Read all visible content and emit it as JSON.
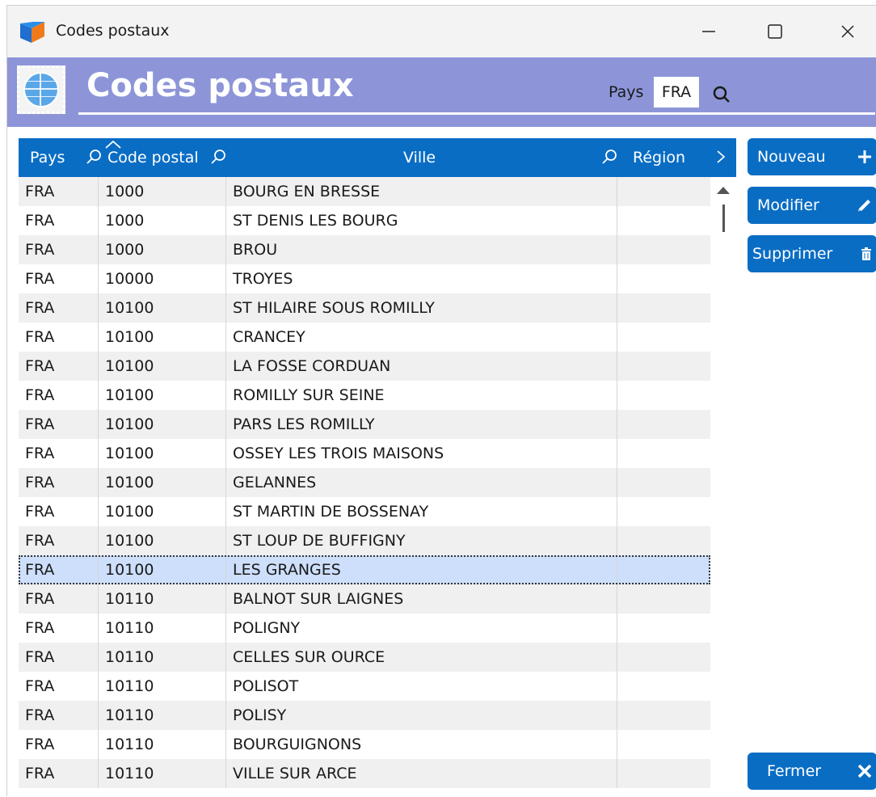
{
  "window": {
    "title": "Codes postaux"
  },
  "header": {
    "title": "Codes postaux",
    "pays_label": "Pays",
    "pays_value": "FRA"
  },
  "table": {
    "columns": [
      "Pays",
      "Code postal",
      "Ville",
      "Région"
    ],
    "rows": [
      {
        "pays": "FRA",
        "code": "1000",
        "ville": "BOURG EN BRESSE",
        "region": ""
      },
      {
        "pays": "FRA",
        "code": "1000",
        "ville": "ST DENIS LES BOURG",
        "region": ""
      },
      {
        "pays": "FRA",
        "code": "1000",
        "ville": "BROU",
        "region": ""
      },
      {
        "pays": "FRA",
        "code": "10000",
        "ville": "TROYES",
        "region": ""
      },
      {
        "pays": "FRA",
        "code": "10100",
        "ville": "ST HILAIRE SOUS ROMILLY",
        "region": ""
      },
      {
        "pays": "FRA",
        "code": "10100",
        "ville": "CRANCEY",
        "region": ""
      },
      {
        "pays": "FRA",
        "code": "10100",
        "ville": "LA FOSSE CORDUAN",
        "region": ""
      },
      {
        "pays": "FRA",
        "code": "10100",
        "ville": "ROMILLY SUR SEINE",
        "region": ""
      },
      {
        "pays": "FRA",
        "code": "10100",
        "ville": "PARS LES ROMILLY",
        "region": ""
      },
      {
        "pays": "FRA",
        "code": "10100",
        "ville": "OSSEY LES TROIS MAISONS",
        "region": ""
      },
      {
        "pays": "FRA",
        "code": "10100",
        "ville": "GELANNES",
        "region": ""
      },
      {
        "pays": "FRA",
        "code": "10100",
        "ville": "ST MARTIN DE BOSSENAY",
        "region": ""
      },
      {
        "pays": "FRA",
        "code": "10100",
        "ville": "ST LOUP DE BUFFIGNY",
        "region": ""
      },
      {
        "pays": "FRA",
        "code": "10100",
        "ville": "LES GRANGES",
        "region": "",
        "selected": true
      },
      {
        "pays": "FRA",
        "code": "10110",
        "ville": "BALNOT SUR LAIGNES",
        "region": ""
      },
      {
        "pays": "FRA",
        "code": "10110",
        "ville": "POLIGNY",
        "region": ""
      },
      {
        "pays": "FRA",
        "code": "10110",
        "ville": "CELLES SUR OURCE",
        "region": ""
      },
      {
        "pays": "FRA",
        "code": "10110",
        "ville": "POLISOT",
        "region": ""
      },
      {
        "pays": "FRA",
        "code": "10110",
        "ville": "POLISY",
        "region": ""
      },
      {
        "pays": "FRA",
        "code": "10110",
        "ville": "BOURGUIGNONS",
        "region": ""
      },
      {
        "pays": "FRA",
        "code": "10110",
        "ville": "VILLE SUR ARCE",
        "region": ""
      }
    ]
  },
  "actions": {
    "nouveau": "Nouveau",
    "modifier": "Modifier",
    "supprimer": "Supprimer",
    "fermer": "Fermer"
  },
  "icons": {
    "app": "app-logo-icon",
    "minimize": "minimize-icon",
    "maximize": "maximize-icon",
    "close": "close-icon",
    "stamp": "globe-stamp-icon",
    "search": "search-icon",
    "plus": "plus-icon",
    "pencil": "pencil-icon",
    "trash": "trash-icon",
    "fermer": "close-x-icon"
  },
  "colors": {
    "header_band": "#8d95d8",
    "accent": "#0a6dc4",
    "selected_row": "#cddffb"
  }
}
